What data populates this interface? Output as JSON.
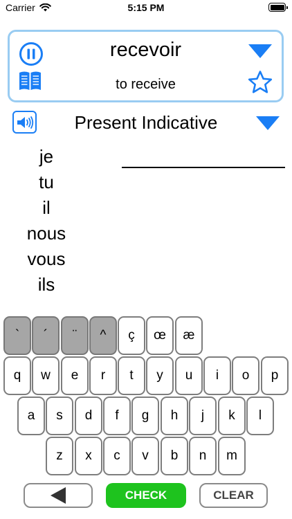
{
  "status_bar": {
    "carrier": "Carrier",
    "time": "5:15 PM",
    "battery_level": 1.0
  },
  "verb": {
    "infinitive": "recevoir",
    "translation": "to receive"
  },
  "tense": {
    "label": "Present Indicative"
  },
  "pronouns": [
    "je",
    "tu",
    "il",
    "nous",
    "vous",
    "ils"
  ],
  "keyboard": {
    "accent_keys": [
      "`",
      "´",
      "¨",
      "^"
    ],
    "special_keys": [
      "ç",
      "œ",
      "æ"
    ],
    "row1": [
      "q",
      "w",
      "e",
      "r",
      "t",
      "y",
      "u",
      "i",
      "o",
      "p"
    ],
    "row2": [
      "a",
      "s",
      "d",
      "f",
      "g",
      "h",
      "j",
      "k",
      "l"
    ],
    "row3": [
      "z",
      "x",
      "c",
      "v",
      "b",
      "n",
      "m"
    ]
  },
  "actions": {
    "check_label": "CHECK",
    "clear_label": "CLEAR"
  },
  "colors": {
    "accent_blue": "#1a7ef5",
    "card_border": "#99ccf2",
    "check_green": "#1ec31e",
    "accent_key_gray": "#a6a6a6"
  },
  "icons": [
    "wifi-icon",
    "battery-icon",
    "pause-icon",
    "book-icon",
    "dropdown-triangle-icon",
    "star-icon",
    "speaker-icon",
    "back-arrow-icon"
  ]
}
